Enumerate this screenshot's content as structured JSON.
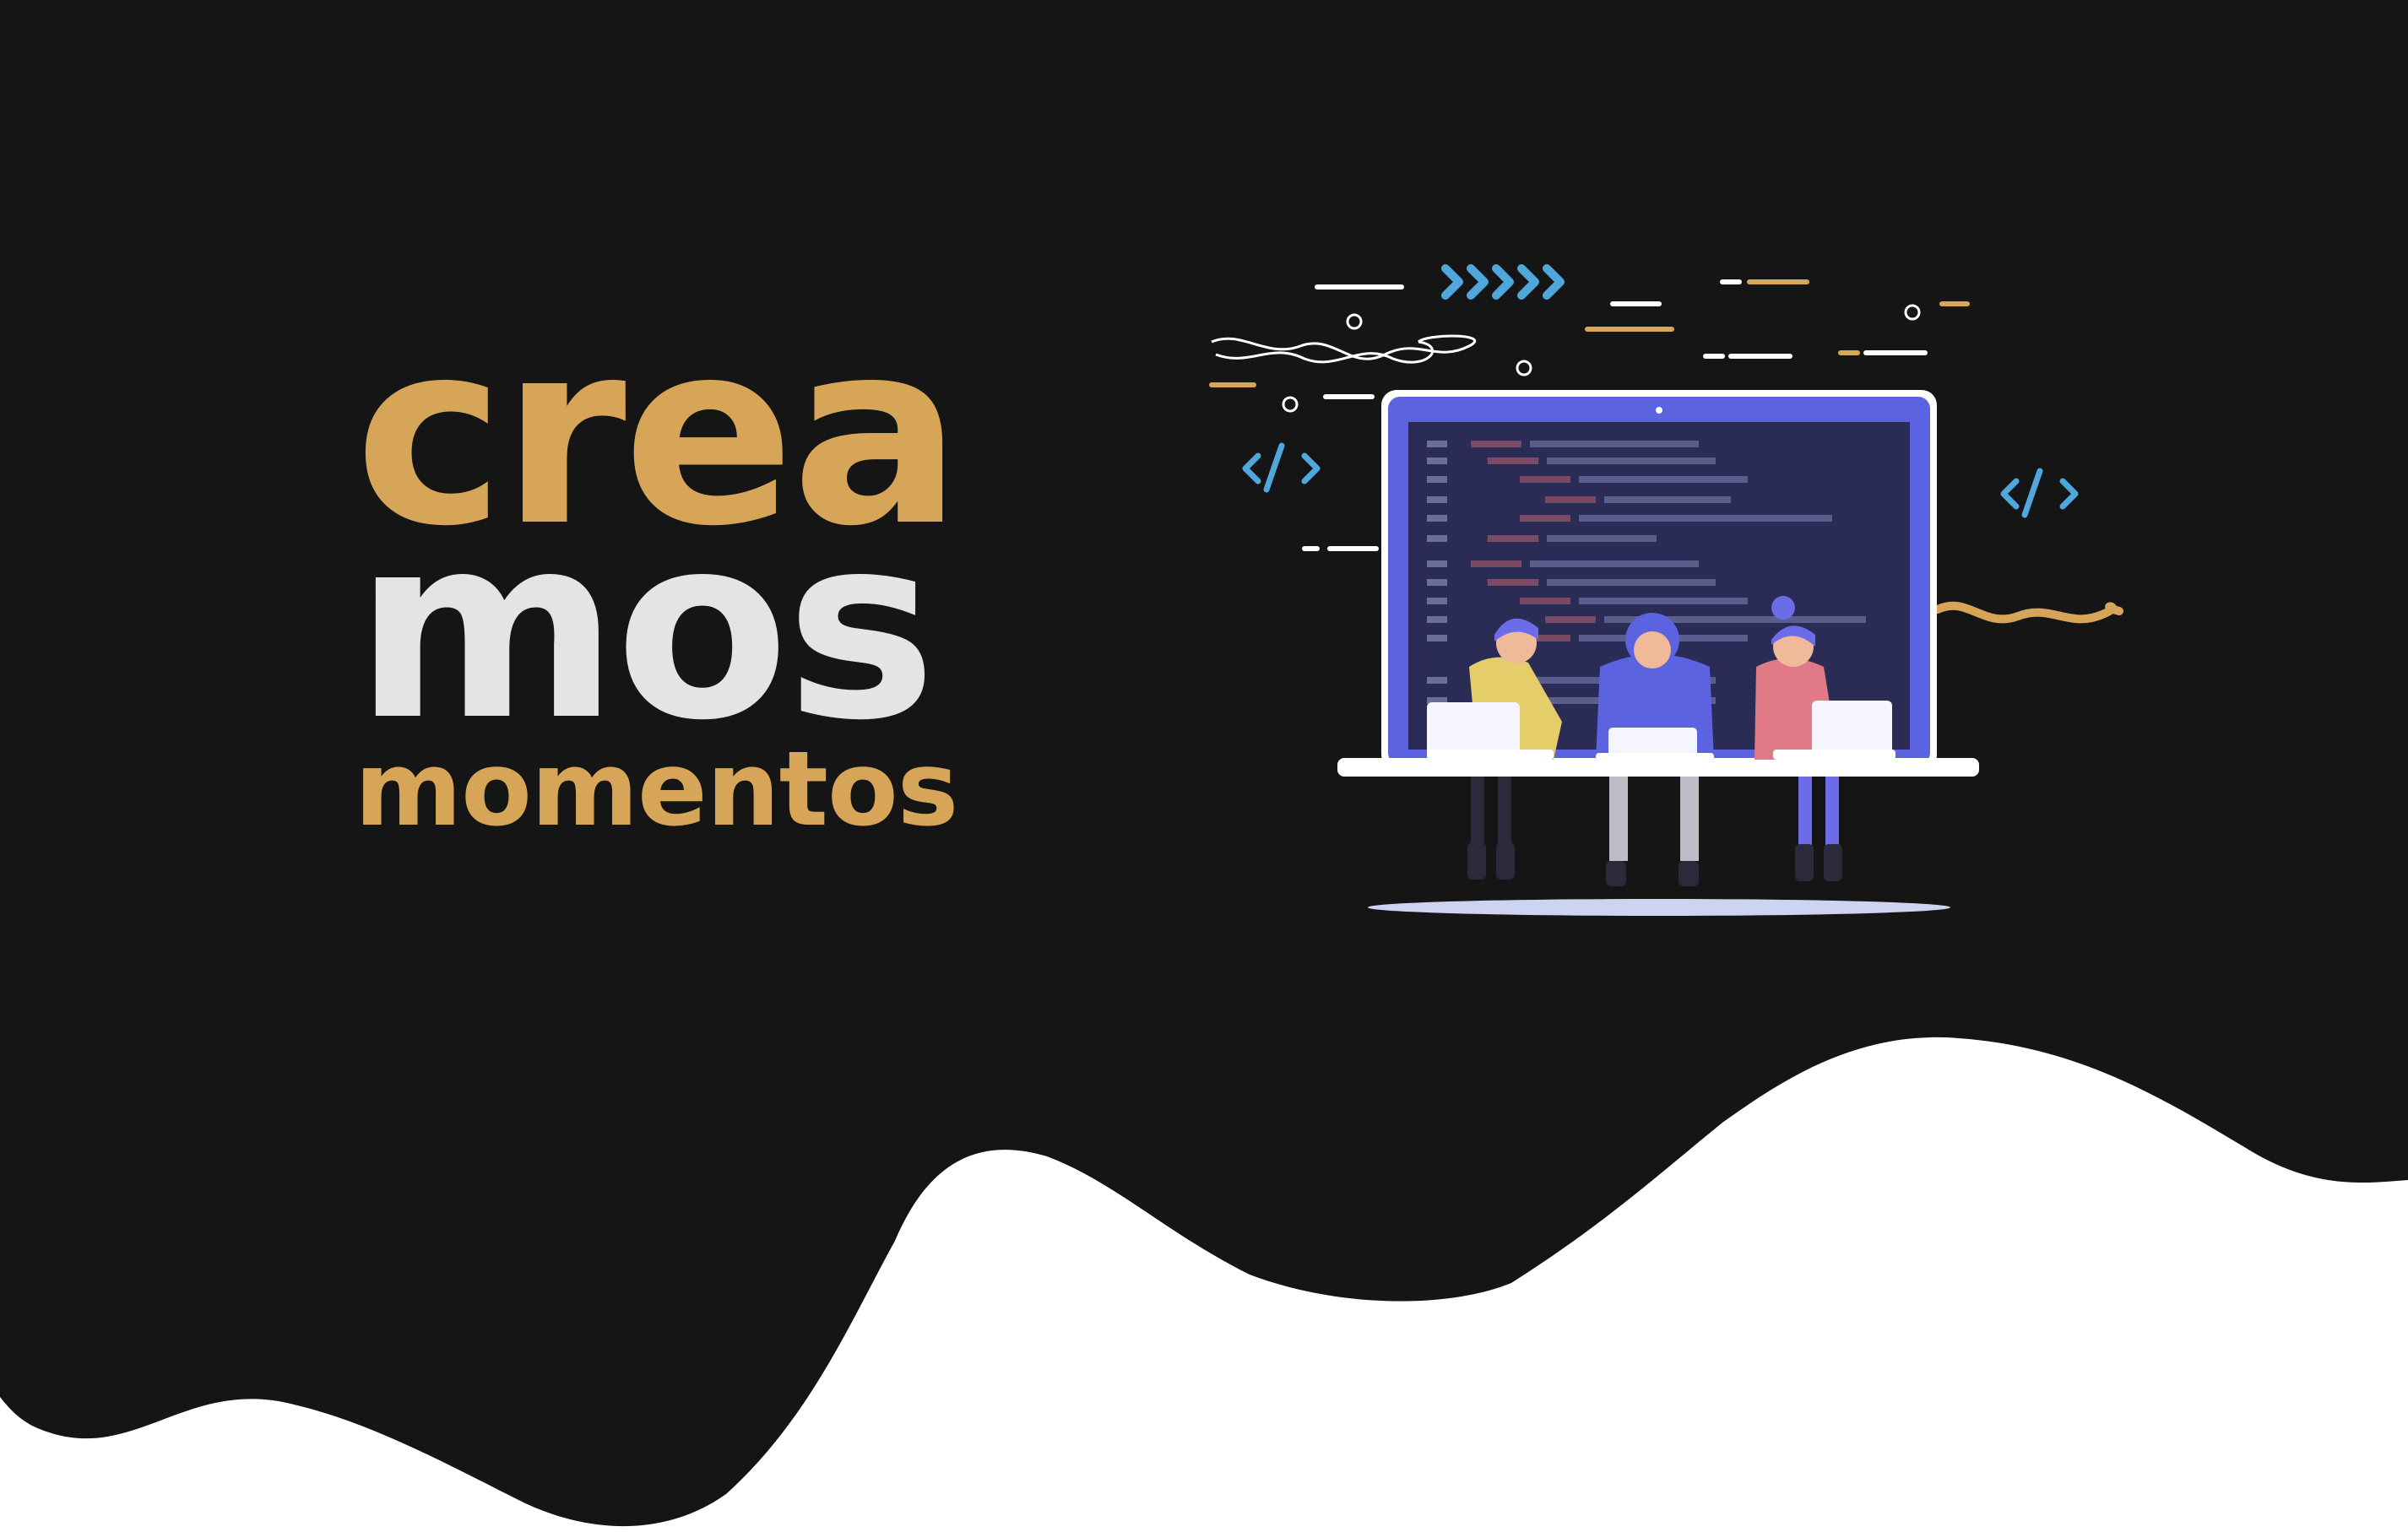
{
  "headline": {
    "line1": "crea",
    "line2": "mos",
    "line3": "momentos"
  },
  "illustration": {
    "code_tag_left": "</>",
    "code_tag_right": "</>",
    "arrows": "»»»»"
  },
  "colors": {
    "background_dark": "#151515",
    "background_light": "#ffffff",
    "gold": "#d6a558",
    "light_gray": "#e4e4e4",
    "screen_frame": "#5b63e0",
    "screen_inner": "#2a2c55",
    "accent_blue": "#4fa7dc",
    "desk": "#ffffff"
  },
  "icons": [
    "chevrons-icon",
    "code-tag-icon",
    "wave-icon",
    "circle-icon",
    "dash-icon"
  ]
}
